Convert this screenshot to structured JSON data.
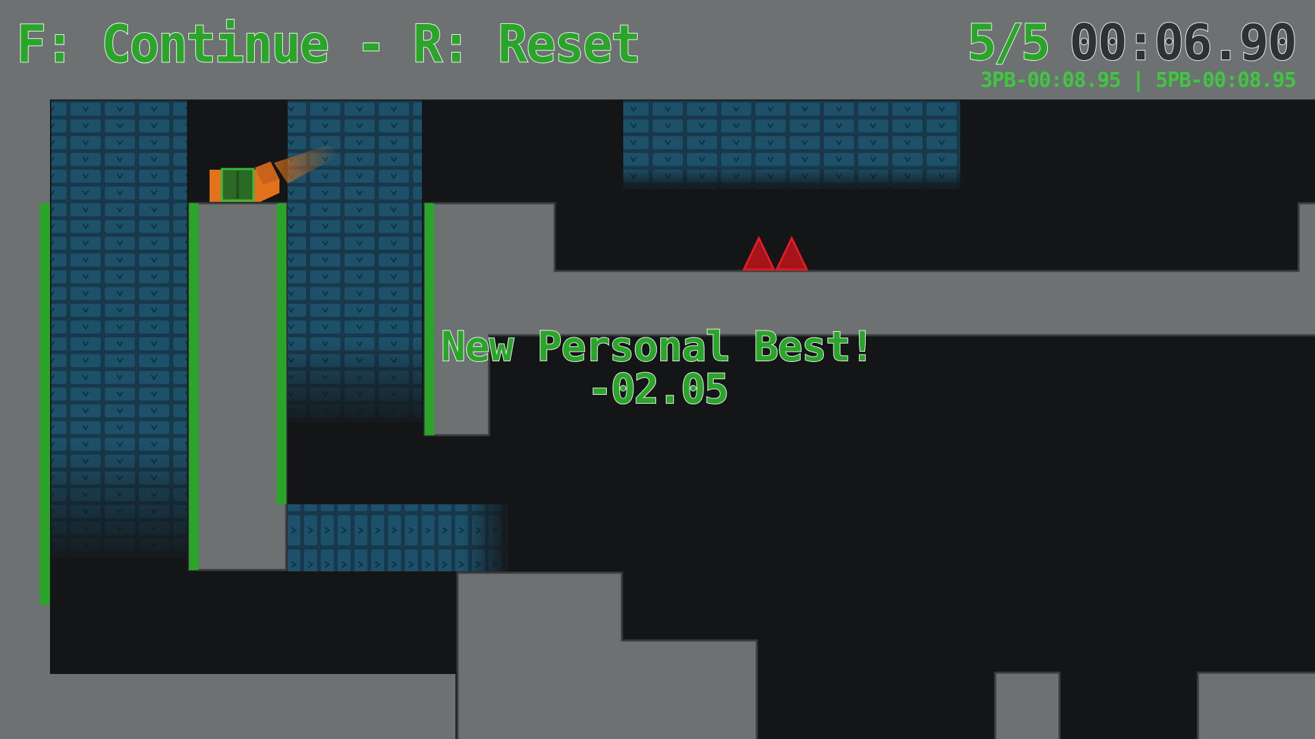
{
  "hud": {
    "controls_hint": "F: Continue - R: Reset",
    "level_counter": "5/5",
    "timer": "00:06.90",
    "personal_bests": "3PB-00:08.95 | 5PB-00:08.95"
  },
  "banner": {
    "title": "New Personal Best!",
    "delta": "-02.05"
  },
  "colors": {
    "background": "#6d7172",
    "void": "#141517",
    "wall": "#6d7172",
    "accent_green": "#2aa52a",
    "hazard_red": "#c0161b",
    "player_orange": "#e2731c",
    "tile_teal": "#18485e"
  },
  "icons": {
    "player": "player-square-icon",
    "hazard": "spike-icon"
  }
}
